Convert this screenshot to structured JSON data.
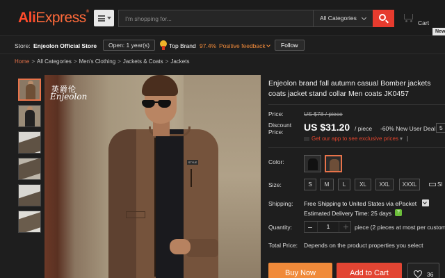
{
  "header": {
    "logo_part1": "Ali",
    "logo_part2": "Express",
    "logo_tm": "®",
    "search_placeholder": "I'm shopping for...",
    "category_selected": "All Categories",
    "cart_label": "Cart",
    "new_badge": "New"
  },
  "store": {
    "label": "Store:",
    "name": "Enjeolon Official Store",
    "open_label": "Open: 1 year(s)",
    "top_brand": "Top Brand",
    "feedback_pct": "97.4%",
    "feedback_label": "Positive feedback",
    "follow_label": "Follow"
  },
  "breadcrumb": {
    "home": "Home",
    "items": [
      "All Categories",
      "Men's Clothing",
      "Jackets & Coats",
      "Jackets"
    ]
  },
  "gallery": {
    "watermark_cn": "英爵伦",
    "watermark_en": "Enjeolon",
    "patch_text": "STYLE"
  },
  "product": {
    "title": "Enjeolon brand fall autumn casual Bomber jackets coats jacket stand collar Men coats JK0457",
    "price_label": "Price:",
    "original_price": "US $78 / piece",
    "discount_label": "Discount Price:",
    "discount_price": "US $31.20",
    "per_piece": "/ piece",
    "discount_note": "-60% New User Deal",
    "deal_select": "5",
    "app_link": "Get our app to see exclusive prices",
    "color_label": "Color:",
    "colors": [
      "black",
      "brown"
    ],
    "size_label": "Size:",
    "sizes": [
      "S",
      "M",
      "L",
      "XL",
      "XXL",
      "XXXL"
    ],
    "size_chart": "SI",
    "shipping_label": "Shipping:",
    "shipping_text": "Free Shipping to United States via ePacket",
    "delivery_label": "Estimated Delivery Time:",
    "delivery_days": "25",
    "delivery_unit": "days",
    "quantity_label": "Quantity:",
    "quantity_value": "1",
    "quantity_note": "piece (2 pieces at most per custom",
    "total_label": "Total Price:",
    "total_value": "Depends on the product properties you select"
  },
  "actions": {
    "buy_now": "Buy Now",
    "add_to_cart": "Add to Cart",
    "wishlist_count": "36"
  }
}
